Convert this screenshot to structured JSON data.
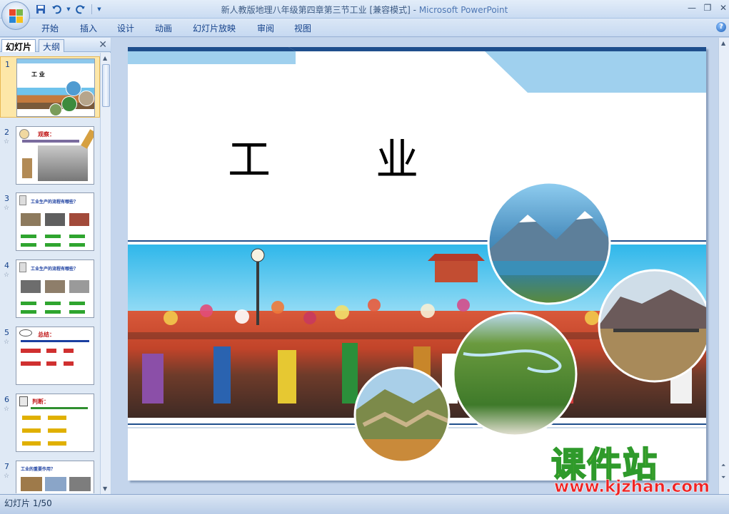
{
  "window": {
    "title": "新人教版地理八年级第四章第三节工业 [兼容模式]",
    "app_name": "Microsoft PowerPoint",
    "title_separator": " - "
  },
  "ribbon": {
    "tabs": [
      "开始",
      "插入",
      "设计",
      "动画",
      "幻灯片放映",
      "审阅",
      "视图"
    ]
  },
  "panel": {
    "tab_slides": "幻灯片",
    "tab_outline": "大纲",
    "thumbnails": [
      {
        "num": "1",
        "title": "工  业"
      },
      {
        "num": "2",
        "title": "观察："
      },
      {
        "num": "3",
        "title": "工业生产的流程有哪些？"
      },
      {
        "num": "4",
        "title": "工业生产的流程有哪些？"
      },
      {
        "num": "5",
        "title": "总结："
      },
      {
        "num": "6",
        "title": "判断："
      },
      {
        "num": "7",
        "title": "工业的重要作用？"
      }
    ]
  },
  "slide": {
    "title": "工  业"
  },
  "status": {
    "slide_indicator": "幻灯片 1/50"
  },
  "watermark": {
    "line1": "课件站",
    "line2": "www.kjzhan.com"
  },
  "colors": {
    "accent_blue": "#1f4e8c",
    "sky": "#6fc3ec",
    "watermark_green": "#2f9a2b",
    "watermark_red": "#ef2323"
  }
}
